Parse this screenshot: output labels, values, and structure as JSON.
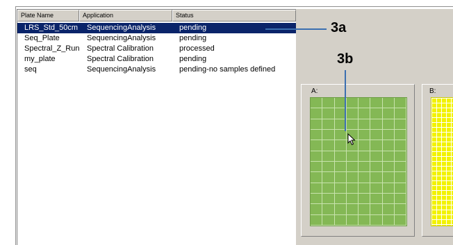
{
  "plate_list": {
    "columns": [
      "Plate Name",
      "Application",
      "Status"
    ],
    "rows": [
      {
        "name": "LRS_Std_50cm",
        "application": "SequencingAnalysis",
        "status": "pending",
        "selected": true
      },
      {
        "name": "Seq_Plate",
        "application": "SequencingAnalysis",
        "status": "pending"
      },
      {
        "name": "Spectral_Z_Run",
        "application": "Spectral Calibration",
        "status": "processed"
      },
      {
        "name": "my_plate",
        "application": "Spectral Calibration",
        "status": "pending"
      },
      {
        "name": "seq",
        "application": "SequencingAnalysis",
        "status": "pending-no samples defined"
      }
    ]
  },
  "callouts": {
    "a": "3a",
    "b": "3b"
  },
  "plates": [
    {
      "title": "A:",
      "color": "#84b855"
    },
    {
      "title": "B:",
      "color": "#f2f200"
    }
  ],
  "colors": {
    "selection": "#0a246a",
    "callout_line": "#3b6fb0"
  }
}
